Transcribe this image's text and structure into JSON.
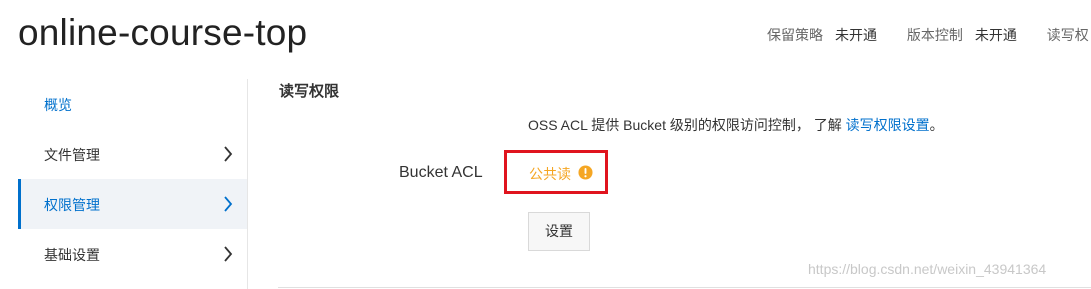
{
  "bucket": {
    "name": "online-course-top"
  },
  "top_meta": [
    {
      "label": "保留策略",
      "value": "未开通"
    },
    {
      "label": "版本控制",
      "value": "未开通"
    },
    {
      "label": "读写权"
    }
  ],
  "sidebar": {
    "items": [
      {
        "label": "概览"
      },
      {
        "label": "文件管理"
      },
      {
        "label": "权限管理"
      },
      {
        "label": "基础设置"
      }
    ]
  },
  "acl_section": {
    "title": "读写权限",
    "description_prefix": "OSS ACL 提供 Bucket 级别的权限访问控制， 了解 ",
    "description_link": "读写权限设置",
    "description_suffix": "。",
    "field_label": "Bucket ACL",
    "value": "公共读",
    "button_label": "设置"
  },
  "watermark": "https://blog.csdn.net/weixin_43941364",
  "colors": {
    "link": "#0070cc",
    "warning": "#f5a623",
    "highlight_border": "#e0141e"
  }
}
